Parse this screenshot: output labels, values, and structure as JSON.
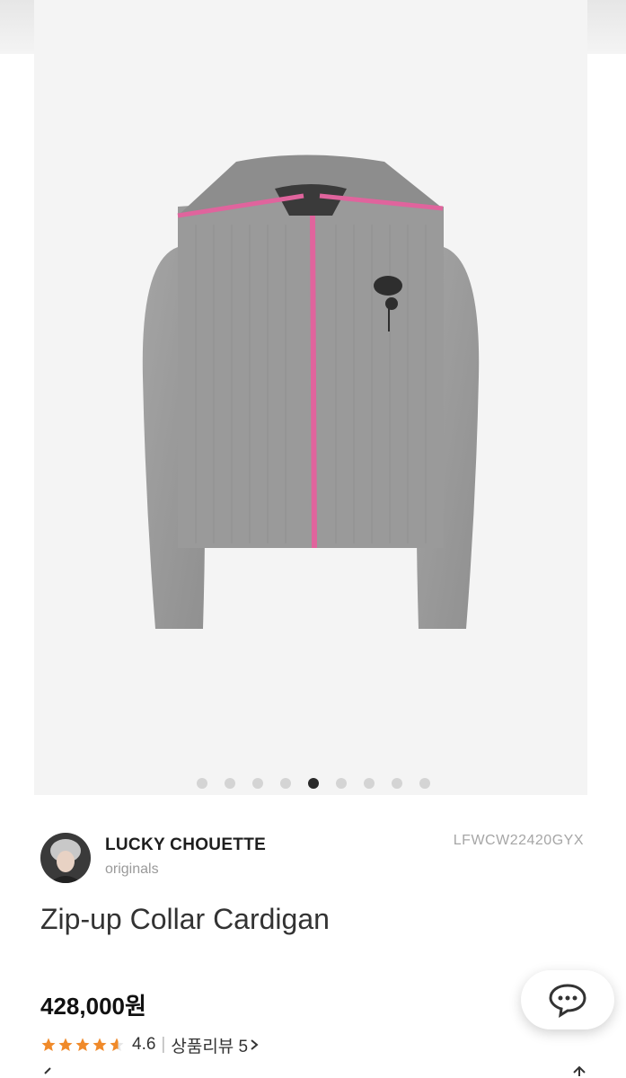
{
  "gallery": {
    "total_images": 9,
    "active_index": 5
  },
  "brand": {
    "name": "LUCKY CHOUETTE",
    "subtitle": "originals",
    "sku": "LFWCW22420GYX"
  },
  "product": {
    "title": "Zip-up Collar Cardigan",
    "price": "428,000원",
    "rating": "4.6",
    "rating_stars_value": 4.6,
    "review_label": "상품리뷰 5"
  },
  "colors": {
    "knit": "#9c9c9c",
    "zip": "#e0649d",
    "star": "#f08a2a",
    "active_dot": "#2a2a2a"
  },
  "icons": {
    "chat": "chat-bubble-icon",
    "review_arrow": "chevron-right-icon"
  }
}
